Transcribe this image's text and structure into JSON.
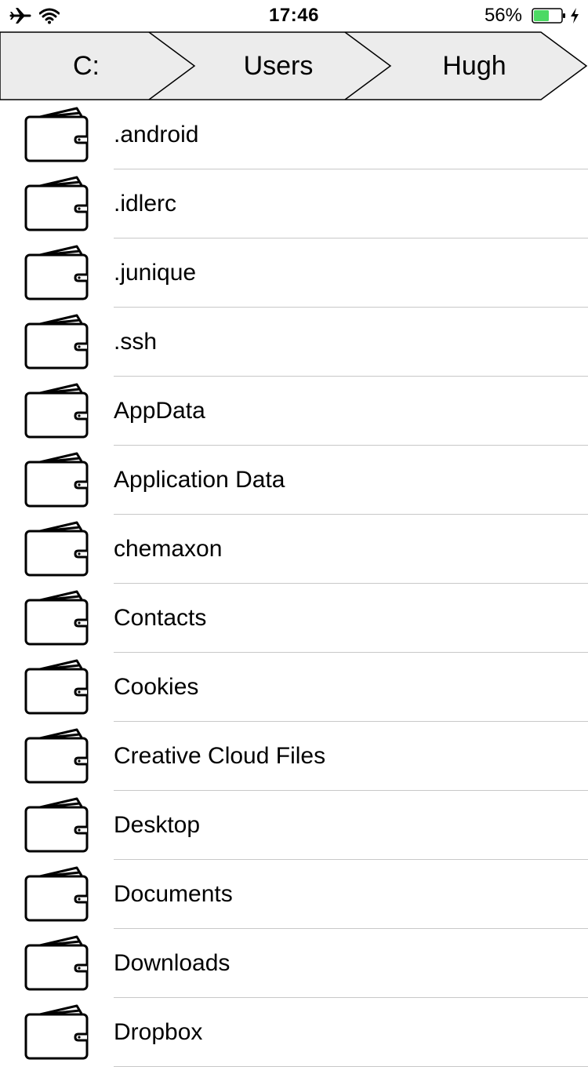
{
  "status_bar": {
    "time": "17:46",
    "battery_percent": "56%",
    "battery_level": 0.56,
    "battery_color": "#4cd964",
    "icons": [
      "airplane-icon",
      "wifi-icon",
      "battery-icon",
      "charging-bolt-icon"
    ]
  },
  "breadcrumb": {
    "background_color": "#ececec",
    "items": [
      {
        "label": "C:"
      },
      {
        "label": "Users"
      },
      {
        "label": "Hugh"
      }
    ]
  },
  "file_list": {
    "icon": "folder-icon",
    "items": [
      {
        "name": ".android"
      },
      {
        "name": ".idlerc"
      },
      {
        "name": ".junique"
      },
      {
        "name": ".ssh"
      },
      {
        "name": "AppData"
      },
      {
        "name": "Application Data"
      },
      {
        "name": "chemaxon"
      },
      {
        "name": "Contacts"
      },
      {
        "name": "Cookies"
      },
      {
        "name": "Creative Cloud Files"
      },
      {
        "name": "Desktop"
      },
      {
        "name": "Documents"
      },
      {
        "name": "Downloads"
      },
      {
        "name": "Dropbox"
      }
    ]
  }
}
